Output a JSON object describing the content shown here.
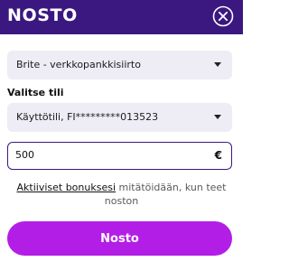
{
  "header": {
    "logo_text": "NOSTO",
    "close_icon": "close-circle-icon"
  },
  "payment_method": {
    "selected": "Brite - verkkopankkisiirto"
  },
  "account": {
    "label": "Valitse tili",
    "selected": "Käyttötili, FI*********013523"
  },
  "amount": {
    "value": "500",
    "currency_symbol": "€"
  },
  "bonus_notice": {
    "link_text": "Aktiiviset bonuksesi",
    "rest_text": " mitätöidään, kun teet noston"
  },
  "submit": {
    "label": "Nosto"
  },
  "colors": {
    "header_bg": "#3b1880",
    "accent": "#b31ee6",
    "field_bg": "#eeedf6"
  }
}
